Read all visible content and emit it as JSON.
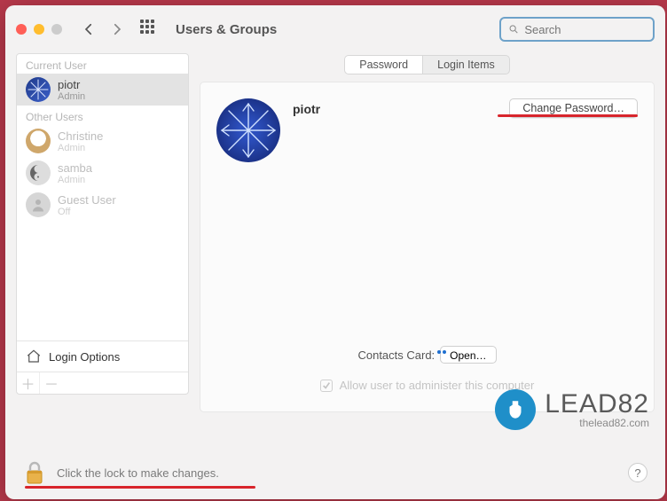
{
  "toolbar": {
    "title": "Users & Groups",
    "search_placeholder": "Search"
  },
  "sidebar": {
    "current_label": "Current User",
    "other_label": "Other Users",
    "login_options_label": "Login Options",
    "users": [
      {
        "name": "piotr",
        "role": "Admin"
      },
      {
        "name": "Christine",
        "role": "Admin"
      },
      {
        "name": "samba",
        "role": "Admin"
      },
      {
        "name": "Guest User",
        "role": "Off"
      }
    ]
  },
  "main": {
    "tabs": {
      "password": "Password",
      "login_items": "Login Items"
    },
    "profile_name": "piotr",
    "change_password_label": "Change Password…",
    "contacts_label": "Contacts Card:",
    "open_label": "Open…",
    "admin_label": "Allow user to administer this computer"
  },
  "footer": {
    "lock_text": "Click the lock to make changes.",
    "help_label": "?"
  },
  "watermark": {
    "big": "LEAD82",
    "small": "thelead82.com"
  }
}
